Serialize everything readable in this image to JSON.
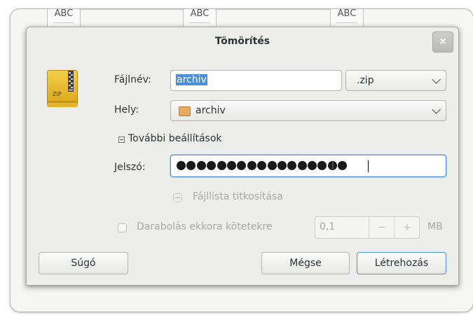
{
  "background": {
    "doc_icon_label": "ABC"
  },
  "dialog": {
    "title": "Tömörítés",
    "close_glyph": "×",
    "icon": {
      "name": "zip-archive-icon",
      "label": "ZIP"
    },
    "filename": {
      "label": "Fájlnév:",
      "value": "archiv"
    },
    "extension": {
      "value": ".zip"
    },
    "location": {
      "label": "Hely:",
      "value": "archiv"
    },
    "more_options": {
      "label": "További beállítások",
      "expanded": true
    },
    "password": {
      "label": "Jelszó:",
      "masked_length": 17
    },
    "encrypt_filelist": {
      "label": "Fájllista titkosítása",
      "enabled": false
    },
    "split": {
      "label": "Darabolás ekkora kötetekre",
      "value": "0,1",
      "unit": "MB",
      "minus": "−",
      "plus": "+",
      "checked": false
    },
    "buttons": {
      "help": "Súgó",
      "cancel": "Mégse",
      "create": "Létrehozás"
    }
  },
  "colors": {
    "accent": "#4a90d9",
    "dialog_bg": "#ededeb",
    "icon_yellow": "#e7b725"
  }
}
